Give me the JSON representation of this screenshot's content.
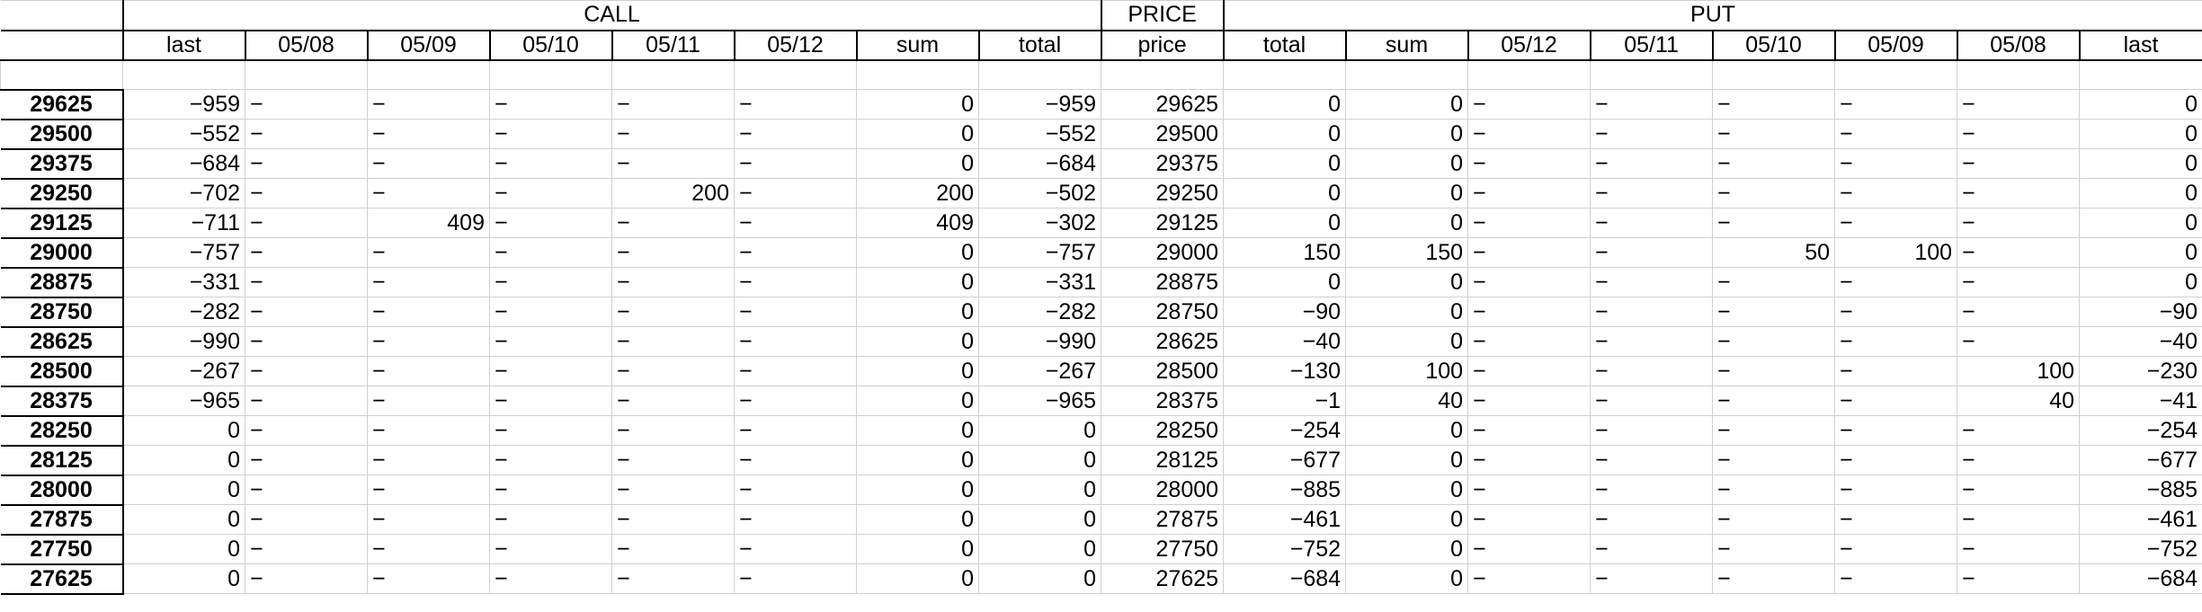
{
  "groups": [
    {
      "label": "",
      "span": 1
    },
    {
      "label": "CALL",
      "span": 8
    },
    {
      "label": "PRICE",
      "span": 1
    },
    {
      "label": "PUT",
      "span": 8
    }
  ],
  "columns": [
    "",
    "last",
    "05/08",
    "05/09",
    "05/10",
    "05/11",
    "05/12",
    "sum",
    "total",
    "price",
    "total",
    "sum",
    "05/12",
    "05/11",
    "05/10",
    "05/09",
    "05/08",
    "last"
  ],
  "rows": [
    {
      "strike": "29625",
      "cells": [
        "−959",
        "−",
        "−",
        "−",
        "−",
        "−",
        "0",
        "−959",
        "29625",
        "0",
        "0",
        "−",
        "−",
        "−",
        "−",
        "−",
        "0"
      ]
    },
    {
      "strike": "29500",
      "cells": [
        "−552",
        "−",
        "−",
        "−",
        "−",
        "−",
        "0",
        "−552",
        "29500",
        "0",
        "0",
        "−",
        "−",
        "−",
        "−",
        "−",
        "0"
      ]
    },
    {
      "strike": "29375",
      "cells": [
        "−684",
        "−",
        "−",
        "−",
        "−",
        "−",
        "0",
        "−684",
        "29375",
        "0",
        "0",
        "−",
        "−",
        "−",
        "−",
        "−",
        "0"
      ]
    },
    {
      "strike": "29250",
      "cells": [
        "−702",
        "−",
        "−",
        "−",
        "200",
        "−",
        "200",
        "−502",
        "29250",
        "0",
        "0",
        "−",
        "−",
        "−",
        "−",
        "−",
        "0"
      ]
    },
    {
      "strike": "29125",
      "cells": [
        "−711",
        "−",
        "409",
        "−",
        "−",
        "−",
        "409",
        "−302",
        "29125",
        "0",
        "0",
        "−",
        "−",
        "−",
        "−",
        "−",
        "0"
      ]
    },
    {
      "strike": "29000",
      "cells": [
        "−757",
        "−",
        "−",
        "−",
        "−",
        "−",
        "0",
        "−757",
        "29000",
        "150",
        "150",
        "−",
        "−",
        "50",
        "100",
        "−",
        "0"
      ]
    },
    {
      "strike": "28875",
      "cells": [
        "−331",
        "−",
        "−",
        "−",
        "−",
        "−",
        "0",
        "−331",
        "28875",
        "0",
        "0",
        "−",
        "−",
        "−",
        "−",
        "−",
        "0"
      ]
    },
    {
      "strike": "28750",
      "cells": [
        "−282",
        "−",
        "−",
        "−",
        "−",
        "−",
        "0",
        "−282",
        "28750",
        "−90",
        "0",
        "−",
        "−",
        "−",
        "−",
        "−",
        "−90"
      ]
    },
    {
      "strike": "28625",
      "cells": [
        "−990",
        "−",
        "−",
        "−",
        "−",
        "−",
        "0",
        "−990",
        "28625",
        "−40",
        "0",
        "−",
        "−",
        "−",
        "−",
        "−",
        "−40"
      ]
    },
    {
      "strike": "28500",
      "cells": [
        "−267",
        "−",
        "−",
        "−",
        "−",
        "−",
        "0",
        "−267",
        "28500",
        "−130",
        "100",
        "−",
        "−",
        "−",
        "−",
        "100",
        "−230"
      ]
    },
    {
      "strike": "28375",
      "cells": [
        "−965",
        "−",
        "−",
        "−",
        "−",
        "−",
        "0",
        "−965",
        "28375",
        "−1",
        "40",
        "−",
        "−",
        "−",
        "−",
        "40",
        "−41"
      ]
    },
    {
      "strike": "28250",
      "cells": [
        "0",
        "−",
        "−",
        "−",
        "−",
        "−",
        "0",
        "0",
        "28250",
        "−254",
        "0",
        "−",
        "−",
        "−",
        "−",
        "−",
        "−254"
      ]
    },
    {
      "strike": "28125",
      "cells": [
        "0",
        "−",
        "−",
        "−",
        "−",
        "−",
        "0",
        "0",
        "28125",
        "−677",
        "0",
        "−",
        "−",
        "−",
        "−",
        "−",
        "−677"
      ]
    },
    {
      "strike": "28000",
      "cells": [
        "0",
        "−",
        "−",
        "−",
        "−",
        "−",
        "0",
        "0",
        "28000",
        "−885",
        "0",
        "−",
        "−",
        "−",
        "−",
        "−",
        "−885"
      ]
    },
    {
      "strike": "27875",
      "cells": [
        "0",
        "−",
        "−",
        "−",
        "−",
        "−",
        "0",
        "0",
        "27875",
        "−461",
        "0",
        "−",
        "−",
        "−",
        "−",
        "−",
        "−461"
      ]
    },
    {
      "strike": "27750",
      "cells": [
        "0",
        "−",
        "−",
        "−",
        "−",
        "−",
        "0",
        "0",
        "27750",
        "−752",
        "0",
        "−",
        "−",
        "−",
        "−",
        "−",
        "−752"
      ]
    },
    {
      "strike": "27625",
      "cells": [
        "0",
        "−",
        "−",
        "−",
        "−",
        "−",
        "0",
        "0",
        "27625",
        "−684",
        "0",
        "−",
        "−",
        "−",
        "−",
        "−",
        "−684"
      ]
    }
  ]
}
